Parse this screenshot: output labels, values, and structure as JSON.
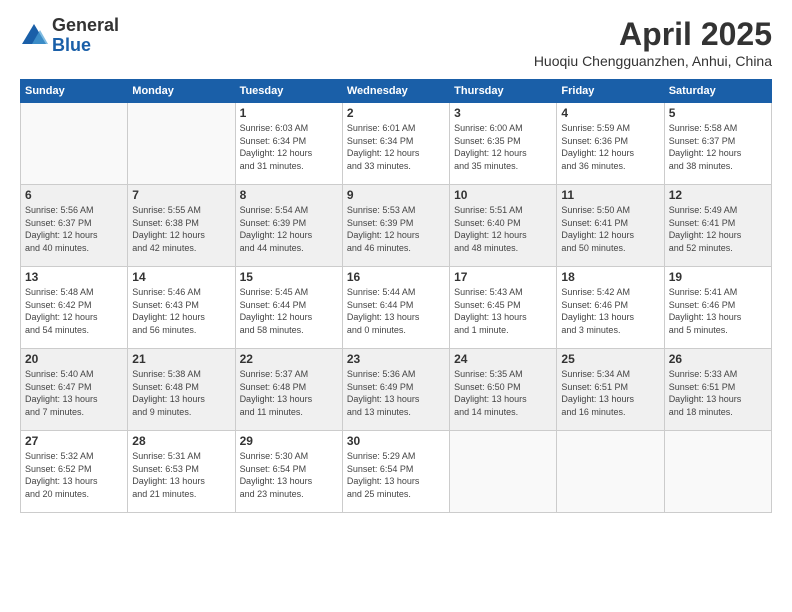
{
  "logo": {
    "general": "General",
    "blue": "Blue"
  },
  "title": "April 2025",
  "location": "Huoqiu Chengguanzhen, Anhui, China",
  "days_of_week": [
    "Sunday",
    "Monday",
    "Tuesday",
    "Wednesday",
    "Thursday",
    "Friday",
    "Saturday"
  ],
  "weeks": [
    [
      {
        "day": "",
        "info": ""
      },
      {
        "day": "",
        "info": ""
      },
      {
        "day": "1",
        "info": "Sunrise: 6:03 AM\nSunset: 6:34 PM\nDaylight: 12 hours\nand 31 minutes."
      },
      {
        "day": "2",
        "info": "Sunrise: 6:01 AM\nSunset: 6:34 PM\nDaylight: 12 hours\nand 33 minutes."
      },
      {
        "day": "3",
        "info": "Sunrise: 6:00 AM\nSunset: 6:35 PM\nDaylight: 12 hours\nand 35 minutes."
      },
      {
        "day": "4",
        "info": "Sunrise: 5:59 AM\nSunset: 6:36 PM\nDaylight: 12 hours\nand 36 minutes."
      },
      {
        "day": "5",
        "info": "Sunrise: 5:58 AM\nSunset: 6:37 PM\nDaylight: 12 hours\nand 38 minutes."
      }
    ],
    [
      {
        "day": "6",
        "info": "Sunrise: 5:56 AM\nSunset: 6:37 PM\nDaylight: 12 hours\nand 40 minutes."
      },
      {
        "day": "7",
        "info": "Sunrise: 5:55 AM\nSunset: 6:38 PM\nDaylight: 12 hours\nand 42 minutes."
      },
      {
        "day": "8",
        "info": "Sunrise: 5:54 AM\nSunset: 6:39 PM\nDaylight: 12 hours\nand 44 minutes."
      },
      {
        "day": "9",
        "info": "Sunrise: 5:53 AM\nSunset: 6:39 PM\nDaylight: 12 hours\nand 46 minutes."
      },
      {
        "day": "10",
        "info": "Sunrise: 5:51 AM\nSunset: 6:40 PM\nDaylight: 12 hours\nand 48 minutes."
      },
      {
        "day": "11",
        "info": "Sunrise: 5:50 AM\nSunset: 6:41 PM\nDaylight: 12 hours\nand 50 minutes."
      },
      {
        "day": "12",
        "info": "Sunrise: 5:49 AM\nSunset: 6:41 PM\nDaylight: 12 hours\nand 52 minutes."
      }
    ],
    [
      {
        "day": "13",
        "info": "Sunrise: 5:48 AM\nSunset: 6:42 PM\nDaylight: 12 hours\nand 54 minutes."
      },
      {
        "day": "14",
        "info": "Sunrise: 5:46 AM\nSunset: 6:43 PM\nDaylight: 12 hours\nand 56 minutes."
      },
      {
        "day": "15",
        "info": "Sunrise: 5:45 AM\nSunset: 6:44 PM\nDaylight: 12 hours\nand 58 minutes."
      },
      {
        "day": "16",
        "info": "Sunrise: 5:44 AM\nSunset: 6:44 PM\nDaylight: 13 hours\nand 0 minutes."
      },
      {
        "day": "17",
        "info": "Sunrise: 5:43 AM\nSunset: 6:45 PM\nDaylight: 13 hours\nand 1 minute."
      },
      {
        "day": "18",
        "info": "Sunrise: 5:42 AM\nSunset: 6:46 PM\nDaylight: 13 hours\nand 3 minutes."
      },
      {
        "day": "19",
        "info": "Sunrise: 5:41 AM\nSunset: 6:46 PM\nDaylight: 13 hours\nand 5 minutes."
      }
    ],
    [
      {
        "day": "20",
        "info": "Sunrise: 5:40 AM\nSunset: 6:47 PM\nDaylight: 13 hours\nand 7 minutes."
      },
      {
        "day": "21",
        "info": "Sunrise: 5:38 AM\nSunset: 6:48 PM\nDaylight: 13 hours\nand 9 minutes."
      },
      {
        "day": "22",
        "info": "Sunrise: 5:37 AM\nSunset: 6:48 PM\nDaylight: 13 hours\nand 11 minutes."
      },
      {
        "day": "23",
        "info": "Sunrise: 5:36 AM\nSunset: 6:49 PM\nDaylight: 13 hours\nand 13 minutes."
      },
      {
        "day": "24",
        "info": "Sunrise: 5:35 AM\nSunset: 6:50 PM\nDaylight: 13 hours\nand 14 minutes."
      },
      {
        "day": "25",
        "info": "Sunrise: 5:34 AM\nSunset: 6:51 PM\nDaylight: 13 hours\nand 16 minutes."
      },
      {
        "day": "26",
        "info": "Sunrise: 5:33 AM\nSunset: 6:51 PM\nDaylight: 13 hours\nand 18 minutes."
      }
    ],
    [
      {
        "day": "27",
        "info": "Sunrise: 5:32 AM\nSunset: 6:52 PM\nDaylight: 13 hours\nand 20 minutes."
      },
      {
        "day": "28",
        "info": "Sunrise: 5:31 AM\nSunset: 6:53 PM\nDaylight: 13 hours\nand 21 minutes."
      },
      {
        "day": "29",
        "info": "Sunrise: 5:30 AM\nSunset: 6:54 PM\nDaylight: 13 hours\nand 23 minutes."
      },
      {
        "day": "30",
        "info": "Sunrise: 5:29 AM\nSunset: 6:54 PM\nDaylight: 13 hours\nand 25 minutes."
      },
      {
        "day": "",
        "info": ""
      },
      {
        "day": "",
        "info": ""
      },
      {
        "day": "",
        "info": ""
      }
    ]
  ]
}
